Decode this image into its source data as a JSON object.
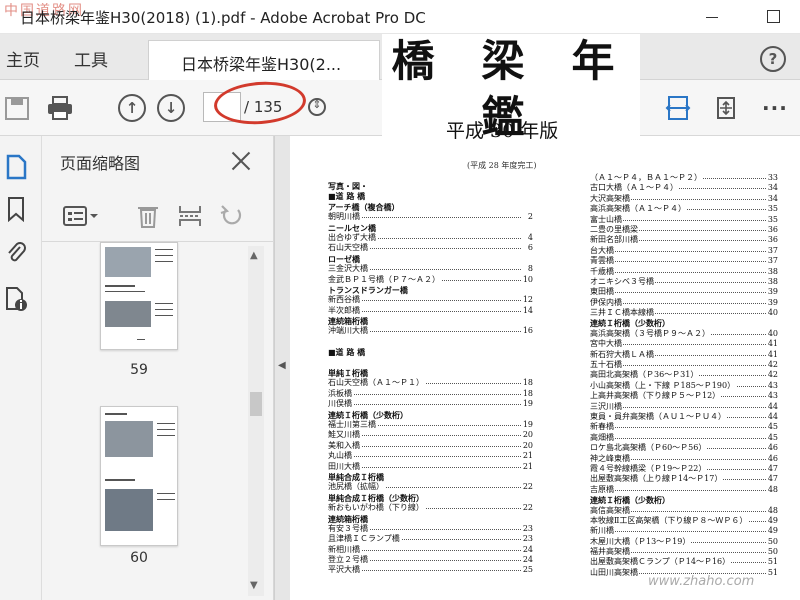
{
  "window": {
    "title": "日本桥梁年鉴H30(2018) (1).pdf - Adobe Acrobat Pro DC",
    "watermark": "中国道路网"
  },
  "tabs": {
    "home": "主页",
    "tools": "工具",
    "document": "日本桥梁年鉴H30(2..."
  },
  "toolbar": {
    "page_current": "",
    "page_total": "/ 135"
  },
  "panel": {
    "title": "页面缩略图",
    "thumb_labels": [
      "59",
      "60"
    ]
  },
  "document": {
    "title": "橋 梁 年 鑑",
    "subtitle": "平成 30 年版",
    "note": "(平成 28 年度完工)",
    "toc_left": [
      {
        "t": "写真・図・",
        "p": "",
        "h": true
      },
      {
        "t": "■道 路 橋",
        "p": "",
        "sec": true
      },
      {
        "t": "アーチ橋（複合橋）",
        "p": "",
        "sec": true
      },
      {
        "t": "  朝明川橋",
        "p": "2"
      },
      {
        "t": "ニールセン橋",
        "p": "",
        "sec": true
      },
      {
        "t": "  出合ゆず大橋",
        "p": "4"
      },
      {
        "t": "  石山天空橋",
        "p": "6"
      },
      {
        "t": "ローゼ橋",
        "p": "",
        "sec": true
      },
      {
        "t": "  三金沢大橋",
        "p": "8"
      },
      {
        "t": "  金武ＢＰ１号橋（Ｐ７〜Ａ２）",
        "p": "10"
      },
      {
        "t": "トランスドランガー橋",
        "p": "",
        "sec": true
      },
      {
        "t": "  新西谷橋",
        "p": "12"
      },
      {
        "t": "  半次郎橋",
        "p": "14"
      },
      {
        "t": "連続箱桁橋",
        "p": "",
        "sec": true
      },
      {
        "t": "  沖端川大橋",
        "p": "16"
      },
      {
        "t": "",
        "p": ""
      },
      {
        "t": "■道 路 橋",
        "p": "",
        "sec": true
      },
      {
        "t": "",
        "p": ""
      },
      {
        "t": "単純Ｉ桁橋",
        "p": "",
        "sec": true
      },
      {
        "t": "  石山天空橋（Ａ１〜Ｐ１）",
        "p": "18"
      },
      {
        "t": "  浜板橋",
        "p": "18"
      },
      {
        "t": "  川俣橋",
        "p": "19"
      },
      {
        "t": "連続Ｉ桁橋（少数桁）",
        "p": "",
        "sec": true
      },
      {
        "t": "  福士川第三橋",
        "p": "19"
      },
      {
        "t": "  鮭又川橋",
        "p": "20"
      },
      {
        "t": "  美和入橋",
        "p": "20"
      },
      {
        "t": "  丸山橋",
        "p": "21"
      },
      {
        "t": "  田川大橋",
        "p": "21"
      },
      {
        "t": "単純合成Ｉ桁橋",
        "p": "",
        "sec": true
      },
      {
        "t": "  池尻橋（拡幅）",
        "p": "22"
      },
      {
        "t": "単純合成Ｉ桁橋（少数桁）",
        "p": "",
        "sec": true
      },
      {
        "t": "  新おもいがわ橋（下り線）",
        "p": "22"
      },
      {
        "t": "連続箱桁橋",
        "p": "",
        "sec": true
      },
      {
        "t": "  有安３号橋",
        "p": "23"
      },
      {
        "t": "  且津橋ＩＣランプ橋",
        "p": "23"
      },
      {
        "t": "  新相川橋",
        "p": "24"
      },
      {
        "t": "  登立２号橋",
        "p": "24"
      },
      {
        "t": "  平沢大橋",
        "p": "25"
      }
    ],
    "toc_right": [
      {
        "t": "  （Ａ１〜Ｐ４，ＢＡ１〜Ｐ２）",
        "p": "33"
      },
      {
        "t": "  古口大橋（Ａ１〜Ｐ４）",
        "p": "34"
      },
      {
        "t": "  大沢高架橋",
        "p": "34"
      },
      {
        "t": "  高浜高架橋（Ａ１〜Ｐ４）",
        "p": "35"
      },
      {
        "t": "  富士山橋",
        "p": "35"
      },
      {
        "t": "  二豊の里橋梁",
        "p": "36"
      },
      {
        "t": "  新田名部川橋",
        "p": "36"
      },
      {
        "t": "  台大橋",
        "p": "37"
      },
      {
        "t": "  青雲橋",
        "p": "37"
      },
      {
        "t": "  千歳橋",
        "p": "38"
      },
      {
        "t": "  オニキシベ３号橋",
        "p": "38"
      },
      {
        "t": "  東田橋",
        "p": "39"
      },
      {
        "t": "  伊保内橋",
        "p": "39"
      },
      {
        "t": "  三井ＩＣ橋本線橋",
        "p": "40"
      },
      {
        "t": "連続Ｉ桁橋（少数桁）",
        "p": "",
        "sec": true
      },
      {
        "t": "  高浜高架橋（３号橋Ｐ９〜Ａ２）",
        "p": "40"
      },
      {
        "t": "  宮中大橋",
        "p": "41"
      },
      {
        "t": "  新石狩大橋ＬＡ橋",
        "p": "41"
      },
      {
        "t": "  五十石橋",
        "p": "42"
      },
      {
        "t": "  高田北高架橋（Ｐ36〜Ｐ31）",
        "p": "42"
      },
      {
        "t": "  小山高架橋（上・下線 Ｐ185〜Ｐ190）",
        "p": "43"
      },
      {
        "t": "  上高井高架橋（下り線Ｐ５〜Ｐ12）",
        "p": "43"
      },
      {
        "t": "  三沢川橋",
        "p": "44"
      },
      {
        "t": "  東員・員弁高架橋（ＡＵ１〜ＰＵ４）",
        "p": "44"
      },
      {
        "t": "  新春橋",
        "p": "45"
      },
      {
        "t": "  高畑橋",
        "p": "45"
      },
      {
        "t": "  ロケ島北高架橋（Ｐ60〜Ｐ56）",
        "p": "46"
      },
      {
        "t": "  神之峰東橋",
        "p": "46"
      },
      {
        "t": "  霞４号幹線橋梁（Ｐ19〜Ｐ22）",
        "p": "47"
      },
      {
        "t": "  出屋敷高架橋（上り線Ｐ14〜Ｐ17）",
        "p": "47"
      },
      {
        "t": "  吉原橋",
        "p": "48"
      },
      {
        "t": "連続Ｉ桁橋（少数桁）",
        "p": "",
        "sec": true
      },
      {
        "t": "  高信高架橋",
        "p": "48"
      },
      {
        "t": "  本牧線Ⅱ工区高架橋（下り線Ｐ８〜ＷＰ６）",
        "p": "49"
      },
      {
        "t": "  新川橋",
        "p": "49"
      },
      {
        "t": "  木屋川大橋（Ｐ13〜Ｐ19）",
        "p": "50"
      },
      {
        "t": "  福井高架橋",
        "p": "50"
      },
      {
        "t": "  出屋敷高架橋Ｃランプ（Ｐ14〜Ｐ16）",
        "p": "51"
      },
      {
        "t": "  山田川高架橋",
        "p": "51"
      }
    ],
    "site_watermark": "www.zhaho.com"
  },
  "colors": {
    "accent_blue": "#2a76c6",
    "annotation_red": "#d23a2c"
  }
}
